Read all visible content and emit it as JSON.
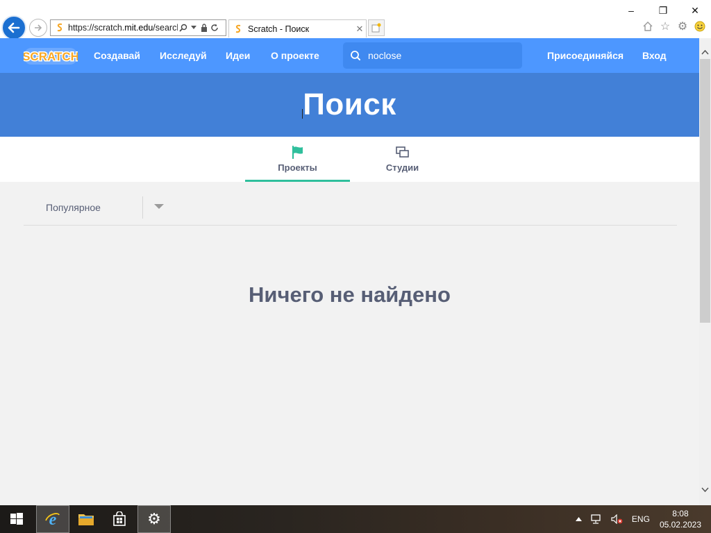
{
  "browser": {
    "address": {
      "prefix": "https://scratch.",
      "host": "mit.edu",
      "path": "/search"
    },
    "tab_title": "Scratch - Поиск",
    "window_controls": {
      "minimize": "–",
      "restore": "❐",
      "close": "✕"
    }
  },
  "scratch": {
    "nav": {
      "create": "Создавай",
      "explore": "Исследуй",
      "ideas": "Идеи",
      "about": "О проекте",
      "join": "Присоединяйся",
      "signin": "Вход"
    },
    "search": {
      "value": "noclose"
    },
    "hero_title": "Поиск",
    "tabs": [
      {
        "label": "Проекты",
        "icon": "flag-icon",
        "active": true
      },
      {
        "label": "Студии",
        "icon": "studios-icon",
        "active": false
      }
    ],
    "filter": {
      "selected": "Популярное"
    },
    "empty_message": "Ничего не найдено"
  },
  "taskbar": {
    "language": "ENG",
    "time": "8:08",
    "date": "05.02.2023"
  },
  "colors": {
    "nav_blue": "#4d97ff",
    "hero_blue": "#4280d7",
    "active_tab_underline": "#2fbf9c",
    "text_gray": "#575e75"
  }
}
